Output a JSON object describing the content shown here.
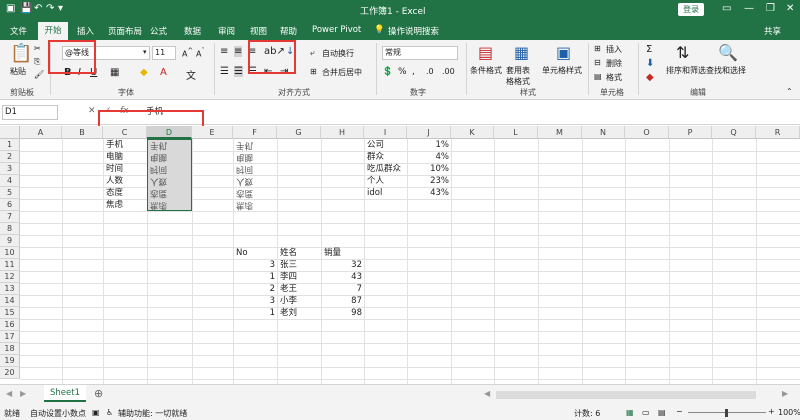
{
  "titlebar": {
    "title": "工作簿1 - Excel",
    "login": "登录",
    "save_icon": "save-icon",
    "undo_icon": "undo-icon",
    "redo_icon": "redo-icon"
  },
  "menu": {
    "tabs": [
      "文件",
      "开始",
      "插入",
      "页面布局",
      "公式",
      "数据",
      "审阅",
      "视图",
      "帮助",
      "Power Pivot"
    ],
    "active_tab": "开始",
    "tell_me": "操作说明搜索",
    "share": "共享"
  },
  "ribbon": {
    "paste": "粘贴",
    "clipboard": "剪贴板",
    "font_name": "@等线",
    "font_size": "11",
    "bold": "B",
    "italic": "I",
    "font_group": "字体",
    "wrap_text": "自动换行",
    "merge_center": "合并后居中",
    "align_group": "对齐方式",
    "number_format": "常规",
    "number_group": "数字",
    "cond_format": "条件格式",
    "table_format": "套用表格格式",
    "cell_style": "单元格样式",
    "style_group": "样式",
    "insert": "插入",
    "delete": "删除",
    "format": "格式",
    "cells_group": "单元格",
    "sort_filter": "排序和筛选",
    "find_select": "查找和选择",
    "edit_group": "编辑"
  },
  "formula": {
    "name_box": "D1",
    "fx": "fx",
    "content": "手机"
  },
  "grid": {
    "columns": [
      "A",
      "B",
      "C",
      "D",
      "E",
      "F",
      "G",
      "H",
      "I",
      "J",
      "K",
      "L",
      "M",
      "N",
      "O",
      "P",
      "Q",
      "R"
    ],
    "rows": [
      "1",
      "2",
      "3",
      "4",
      "5",
      "6",
      "7",
      "8",
      "9",
      "10",
      "11",
      "12",
      "13",
      "14",
      "15",
      "16",
      "17",
      "18",
      "19",
      "20"
    ],
    "c_values": [
      "手机",
      "电脑",
      "时间",
      "人数",
      "态度",
      "焦虑"
    ],
    "d_values": [
      "手机",
      "电脑",
      "时间",
      "人数",
      "态度",
      "焦虑"
    ],
    "f_values": [
      "手机",
      "电脑",
      "时间",
      "人数",
      "态度",
      "焦虑"
    ],
    "i_values": [
      "公司",
      "群众",
      "吃瓜群众",
      "个人",
      "idol"
    ],
    "j_values": [
      "1%",
      "4%",
      "10%",
      "23%",
      "43%"
    ],
    "table_headers": [
      "No",
      "姓名",
      "销量"
    ],
    "table_rows": [
      [
        "3",
        "张三",
        "32"
      ],
      [
        "1",
        "李四",
        "43"
      ],
      [
        "2",
        "老王",
        "7"
      ],
      [
        "3",
        "小李",
        "87"
      ],
      [
        "1",
        "老刘",
        "98"
      ]
    ]
  },
  "sheets": {
    "tab": "Sheet1"
  },
  "status": {
    "ready": "就绪",
    "auto_decimal": "自动设置小数点",
    "accessibility": "辅助功能: 一切就绪",
    "count": "计数: 6",
    "zoom": "100%"
  },
  "colors": {
    "brand": "#217346",
    "highlight": "#e53935",
    "selection": "#d9d9d9"
  }
}
